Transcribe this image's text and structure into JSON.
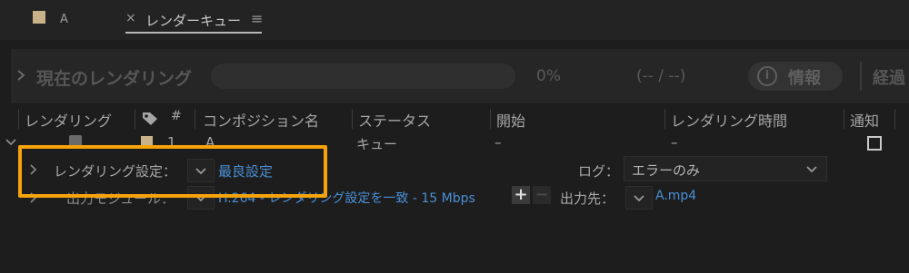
{
  "tabs": [
    {
      "label": "A"
    },
    {
      "close": "×",
      "label": "レンダーキュー",
      "menu": "≡"
    }
  ],
  "status": {
    "title": "現在のレンダリング",
    "percent": "0%",
    "time": "(-- / --)",
    "info_label": "情報",
    "info_glyph": "i",
    "elapsed_label": "経過"
  },
  "columns": [
    "レンダリング",
    "#",
    "コンポジション名",
    "ステータス",
    "開始",
    "レンダリング時間",
    "通知"
  ],
  "row": {
    "number": "1",
    "comp_name": "A",
    "status": "キュー",
    "start": "–",
    "render_time": "–"
  },
  "render_settings": {
    "label": "レンダリング設定：",
    "value": "最良設定",
    "log_label": "ログ：",
    "log_value": "エラーのみ"
  },
  "output_module": {
    "label": "出力モジュール：",
    "value": "H.264 - レンダリング設定を一致 - 15 Mbps",
    "add": "+",
    "remove": "−",
    "dest_label": "出力先：",
    "dest_value": "A.mp4"
  },
  "colors": {
    "highlight": "#f5a30a",
    "link": "#4a8fd6",
    "label_swatch": "#c9b18a"
  }
}
